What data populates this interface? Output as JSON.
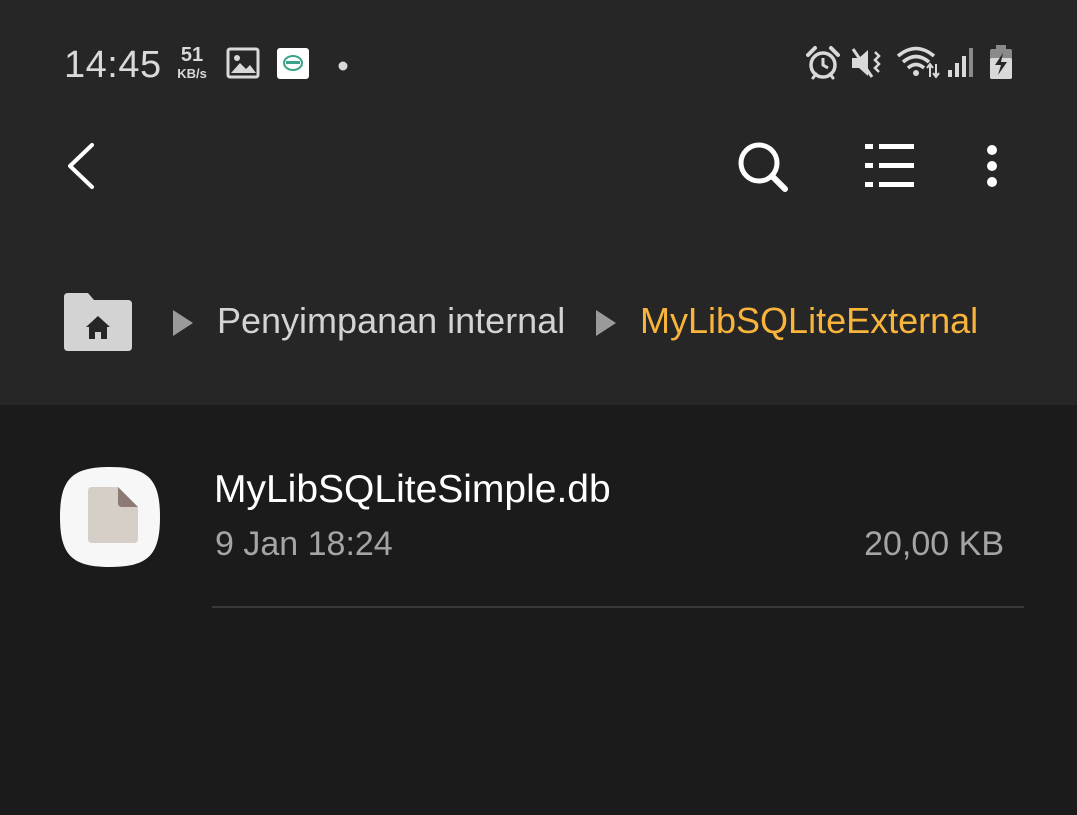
{
  "status_bar": {
    "time": "14:45",
    "net_speed_value": "51",
    "net_speed_unit": "KB/s",
    "icons": [
      "gallery-icon",
      "app-notification-icon",
      "dot-icon",
      "alarm-icon",
      "vibrate-mute-icon",
      "wifi-icon",
      "signal-icon",
      "battery-charging-icon"
    ]
  },
  "app_bar": {
    "icons": [
      "back-icon",
      "search-icon",
      "list-view-icon",
      "more-options-icon"
    ]
  },
  "breadcrumb": {
    "home_icon": "home-folder-icon",
    "items": [
      {
        "label": "Penyimpanan internal",
        "current": false
      },
      {
        "label": "MyLibSQLiteExternal",
        "current": true
      }
    ],
    "current_color": "#f9b43c"
  },
  "files": [
    {
      "name": "MyLibSQLiteSimple.db",
      "date": "9 Jan 18:24",
      "size": "20,00 KB",
      "icon": "document-file-icon"
    }
  ]
}
